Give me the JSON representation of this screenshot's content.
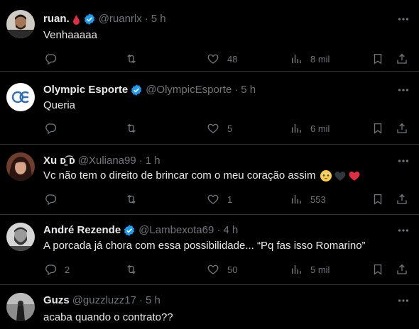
{
  "tweets": [
    {
      "name": "ruan.",
      "handle": "@ruanrlx",
      "separator": "·",
      "time": "5 h",
      "text": "Venhaaaaa",
      "verified": true,
      "name_emoji": "blood-drop",
      "replies": "",
      "retweets": "",
      "likes": "48",
      "views": "8 mil",
      "avatar": "man-dark-beard"
    },
    {
      "name": "Olympic Esporte",
      "handle": "@OlympicEsporte",
      "separator": "·",
      "time": "5 h",
      "text": "Queria",
      "verified": true,
      "replies": "",
      "retweets": "",
      "likes": "5",
      "views": "6 mil",
      "avatar": "oe-logo"
    },
    {
      "name": "Xu ᴅ̱͡ ᴅ",
      "handle": "@Xuliana99",
      "separator": "·",
      "time": "1 h",
      "text": "Vc não tem o direito de brincar com o meu coração assim",
      "text_emojis": [
        "pleading-face",
        "black-heart",
        "red-heart"
      ],
      "verified": false,
      "replies": "",
      "retweets": "",
      "likes": "1",
      "views": "553",
      "avatar": "woman-dark-hair"
    },
    {
      "name": "André Rezende",
      "handle": "@Lambexota69",
      "separator": "·",
      "time": "4 h",
      "text": "A porcada já chora com essa possibilidade... “Pq fas isso Romarino”",
      "verified": true,
      "replies": "2",
      "retweets": "",
      "likes": "50",
      "views": "5 mil",
      "avatar": "man-beard-bw"
    },
    {
      "name": "Guzs",
      "handle": "@guzzluzz17",
      "separator": "·",
      "time": "5 h",
      "text": "acaba quando o contrato??",
      "verified": false,
      "avatar": "figure-gray"
    }
  ],
  "colors": {
    "background": "#000000",
    "text": "#e7e9ea",
    "muted": "#71767b",
    "divider": "#2f3336",
    "verified": "#1d9bf0"
  }
}
